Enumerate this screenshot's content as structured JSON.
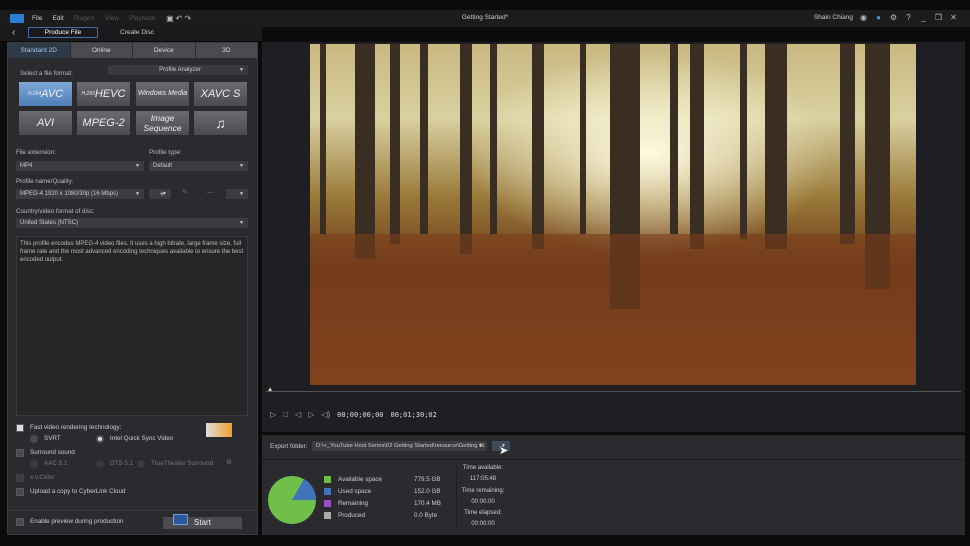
{
  "menubar": {
    "items": [
      "File",
      "Edit",
      "Plugins",
      "View",
      "Playback"
    ],
    "title": "Getting Started*",
    "user": "Shain Chiang"
  },
  "produce": {
    "tab_produce": "Produce File",
    "tab_disc": "Create Disc"
  },
  "tabs": [
    "Standard 2D",
    "Online",
    "Device",
    "3D"
  ],
  "format": {
    "select_label": "Select a file format:",
    "analyzer": "Profile Analyzer",
    "buttons": [
      {
        "sup": "H.264",
        "label": "AVC"
      },
      {
        "sup": "H.265",
        "label": "HEVC"
      },
      {
        "sup": "",
        "label": "Windows Media"
      },
      {
        "sup": "",
        "label": "XAVC S"
      },
      {
        "sup": "",
        "label": "AVI"
      },
      {
        "sup": "",
        "label": "MPEG-2"
      },
      {
        "sup": "",
        "label": "Image Sequence"
      },
      {
        "sup": "",
        "label": "♫"
      }
    ]
  },
  "settings": {
    "ext_label": "File extension:",
    "ext_value": "MP4",
    "ptype_label": "Profile type:",
    "ptype_value": "Default",
    "profile_label": "Profile name/Quality:",
    "profile_value": "MPEG-4 1920 x 1080/30p (16 Mbps)",
    "country_label": "Country/video format of disc:",
    "country_value": "United States (NTSC)",
    "description": "This profile encodes MPEG-4 video files. It uses a high bitrate, large frame size, full frame rate and the most advanced encoding techniques available to ensure the best encoded output."
  },
  "options": {
    "fast": "Fast video rendering technology:",
    "svrt": "SVRT",
    "intel": "Intel Quick Sync Video",
    "surround": "Surround sound",
    "aac": "AAC 5.1",
    "dts": "DTS 5.1",
    "truetheater": "TrueTheater Surround",
    "xvcolor": "x.v.Color",
    "upload": "Upload a copy to CyberLink Cloud",
    "preview": "Enable preview during production",
    "start": "Start"
  },
  "player": {
    "current": "00;00;00;00",
    "duration": "00;01;30;02"
  },
  "export": {
    "label": "Export folder:",
    "path": "D:\\+_YouTube Host Series\\02 Getting Started\\resource\\Getting St",
    "browse": "..."
  },
  "space": {
    "items": [
      {
        "label": "Available space",
        "value": "779.5  GB",
        "color": "#6fbf4a"
      },
      {
        "label": "Used space",
        "value": "152.0  GB",
        "color": "#3f74b8"
      },
      {
        "label": "Remaining",
        "value": "170.4  MB",
        "color": "#9b4fc0"
      },
      {
        "label": "Produced",
        "value": "0.0  Byte",
        "color": "#aaaaaa"
      }
    ],
    "time_available_label": "Time available:",
    "time_available": "117:05:48",
    "time_remaining_label": "Time remaining:",
    "time_remaining": "00:00:00",
    "time_elapsed_label": "Time elapsed:",
    "time_elapsed": "00:00:00"
  }
}
